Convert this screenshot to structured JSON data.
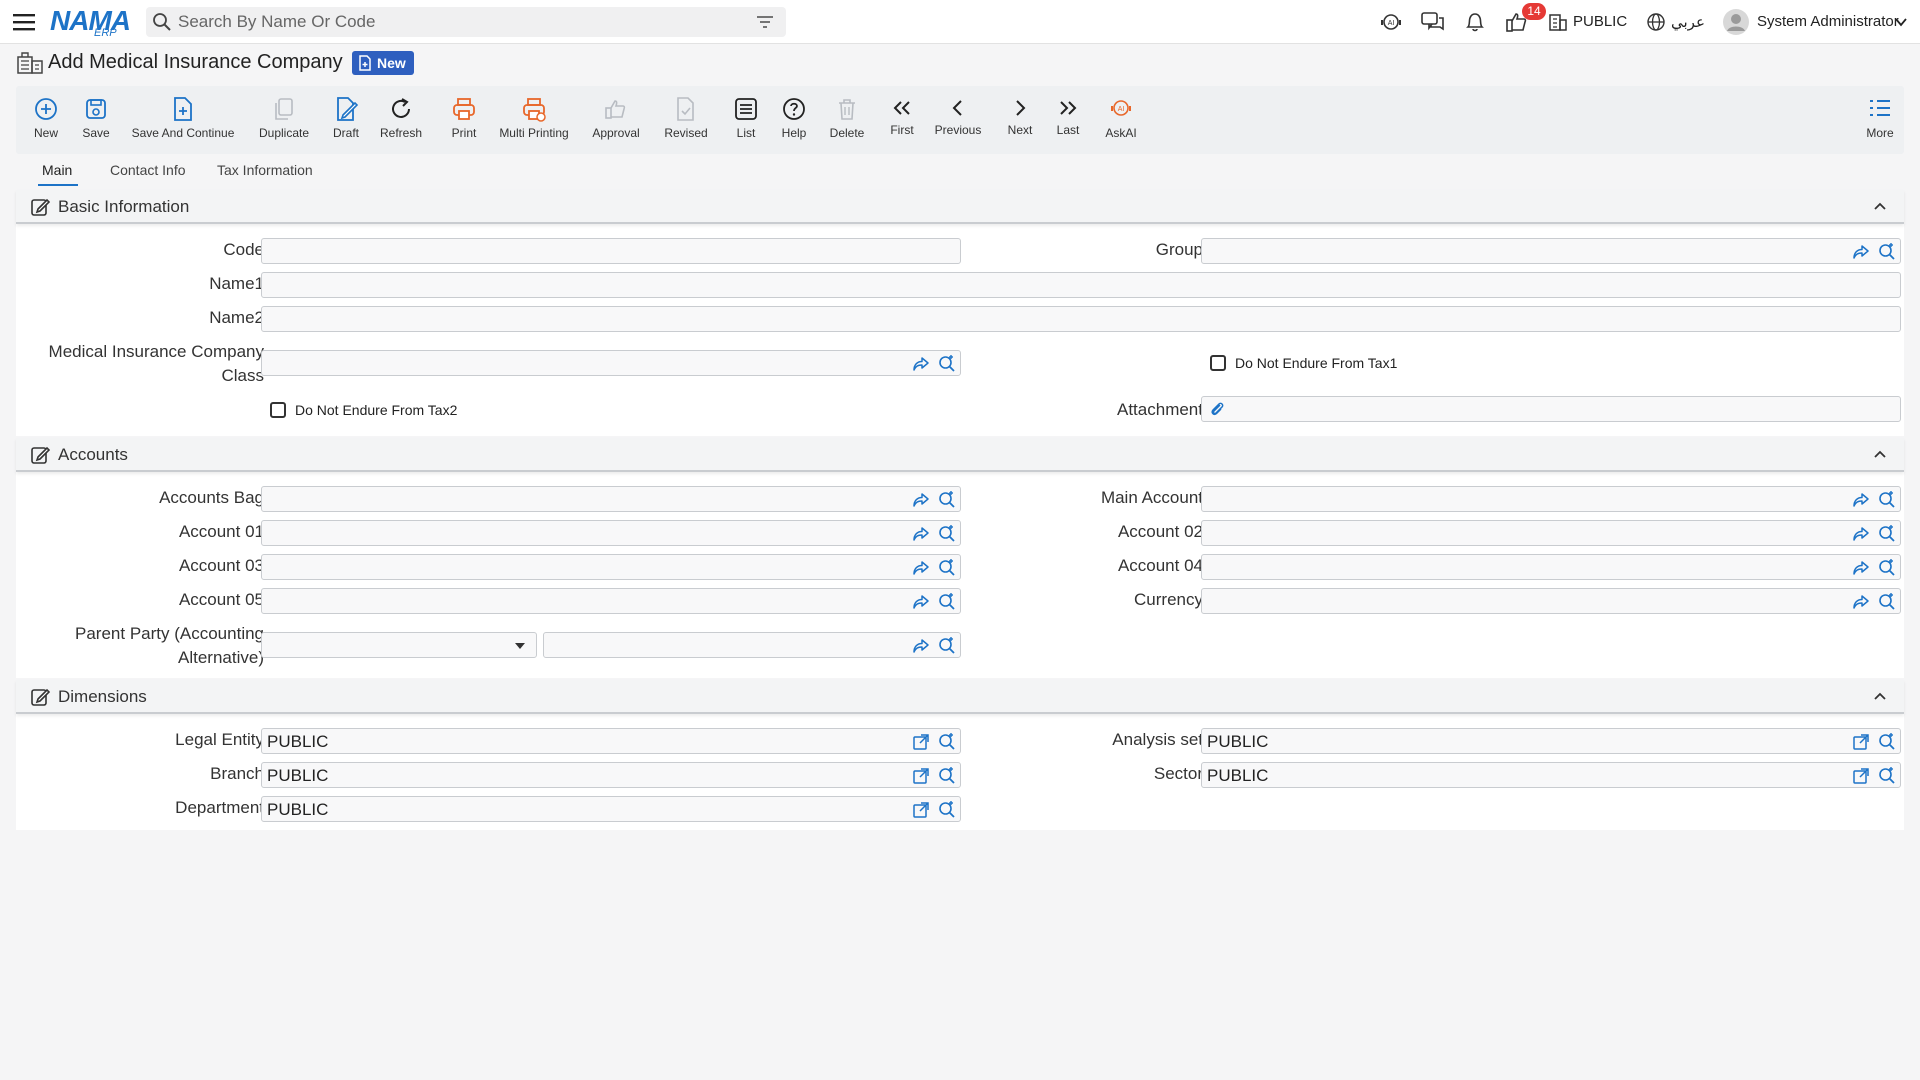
{
  "app": {
    "brand_main": "NAMA",
    "brand_sub": "ERP"
  },
  "search": {
    "placeholder": "Search By Name Or Code"
  },
  "header": {
    "notifications_count": "14",
    "legal_entity": "PUBLIC",
    "language": "عربي",
    "user": "System Administrator"
  },
  "page": {
    "title": "Add Medical Insurance Company",
    "badge": "New"
  },
  "toolbar": {
    "new": "New",
    "save": "Save",
    "save_continue": "Save And Continue",
    "duplicate": "Duplicate",
    "draft": "Draft",
    "refresh": "Refresh",
    "print": "Print",
    "multi_printing": "Multi Printing",
    "approval": "Approval",
    "revised": "Revised",
    "list": "List",
    "help": "Help",
    "delete": "Delete",
    "first": "First",
    "previous": "Previous",
    "next": "Next",
    "last": "Last",
    "askai": "AskAI",
    "more": "More"
  },
  "tabs": {
    "main": "Main",
    "contact": "Contact Info",
    "tax": "Tax Information"
  },
  "basic": {
    "title": "Basic Information",
    "code": "Code",
    "group": "Group",
    "name1": "Name1",
    "name2": "Name2",
    "class_line1": "Medical Insurance Company",
    "class_line2": "Class",
    "tax1": "Do Not Endure From Tax1",
    "tax2": "Do Not Endure From Tax2",
    "attachment": "Attachment"
  },
  "accounts": {
    "title": "Accounts",
    "bag": "Accounts Bag",
    "main": "Main Account",
    "a01": "Account 01",
    "a02": "Account 02",
    "a03": "Account 03",
    "a04": "Account 04",
    "a05": "Account 05",
    "currency": "Currency",
    "parent_line1": "Parent Party (Accounting",
    "parent_line2": "Alternative)"
  },
  "dimensions": {
    "title": "Dimensions",
    "legal_entity": "Legal Entity",
    "legal_entity_val": "PUBLIC",
    "analysis_set": "Analysis set",
    "analysis_set_val": "PUBLIC",
    "branch": "Branch",
    "branch_val": "PUBLIC",
    "sector": "Sector",
    "sector_val": "PUBLIC",
    "department": "Department",
    "department_val": "PUBLIC"
  },
  "colors": {
    "brand": "#1d73c7",
    "accent_orange": "#e8672a",
    "badge_red": "#e53935",
    "badge_blue": "#2e5fbf",
    "toolbar_bg": "#eef0f2"
  }
}
